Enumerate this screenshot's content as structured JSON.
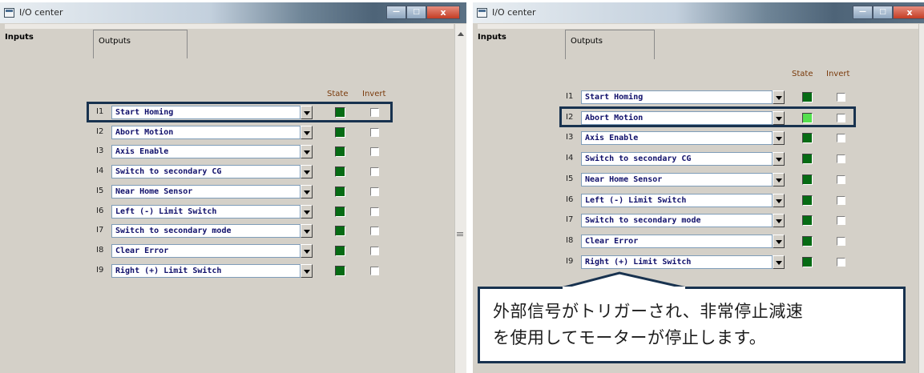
{
  "left_window": {
    "title": "I/O center",
    "tabs": {
      "inputs": "Inputs",
      "outputs": "Outputs"
    },
    "headers": {
      "state": "State",
      "invert": "Invert"
    },
    "rows": [
      {
        "index": "I1",
        "function": "Start Homing",
        "state_on": false,
        "invert": false
      },
      {
        "index": "I2",
        "function": "Abort Motion",
        "state_on": false,
        "invert": false
      },
      {
        "index": "I3",
        "function": "Axis Enable",
        "state_on": false,
        "invert": false
      },
      {
        "index": "I4",
        "function": "Switch to secondary CG",
        "state_on": false,
        "invert": false
      },
      {
        "index": "I5",
        "function": "Near Home Sensor",
        "state_on": false,
        "invert": false
      },
      {
        "index": "I6",
        "function": "Left (-) Limit Switch",
        "state_on": false,
        "invert": false
      },
      {
        "index": "I7",
        "function": "Switch to secondary mode",
        "state_on": false,
        "invert": false
      },
      {
        "index": "I8",
        "function": "Clear Error",
        "state_on": false,
        "invert": false
      },
      {
        "index": "I9",
        "function": "Right (+) Limit Switch",
        "state_on": false,
        "invert": false
      }
    ]
  },
  "right_window": {
    "title": "I/O center",
    "tabs": {
      "inputs": "Inputs",
      "outputs": "Outputs"
    },
    "headers": {
      "state": "State",
      "invert": "Invert"
    },
    "rows": [
      {
        "index": "I1",
        "function": "Start Homing",
        "state_on": false,
        "invert": false
      },
      {
        "index": "I2",
        "function": "Abort Motion",
        "state_on": true,
        "invert": false
      },
      {
        "index": "I3",
        "function": "Axis Enable",
        "state_on": false,
        "invert": false
      },
      {
        "index": "I4",
        "function": "Switch to secondary CG",
        "state_on": false,
        "invert": false
      },
      {
        "index": "I5",
        "function": "Near Home Sensor",
        "state_on": false,
        "invert": false
      },
      {
        "index": "I6",
        "function": "Left (-) Limit Switch",
        "state_on": false,
        "invert": false
      },
      {
        "index": "I7",
        "function": "Switch to secondary mode",
        "state_on": false,
        "invert": false
      },
      {
        "index": "I8",
        "function": "Clear Error",
        "state_on": false,
        "invert": false
      },
      {
        "index": "I9",
        "function": "Right (+) Limit Switch",
        "state_on": false,
        "invert": false
      }
    ]
  },
  "window_controls": {
    "minimize": "—",
    "maximize": "□",
    "close": "x"
  },
  "callout": {
    "lines": [
      "外部信号がトリガーされ、非常停止減速",
      "を使用してモーターが停止します。"
    ]
  },
  "colors": {
    "highlight_border": "#18324f",
    "led_off": "#066b14",
    "led_on": "#55e04f",
    "field_text": "#10106b",
    "header_text": "#7a3a0b"
  }
}
